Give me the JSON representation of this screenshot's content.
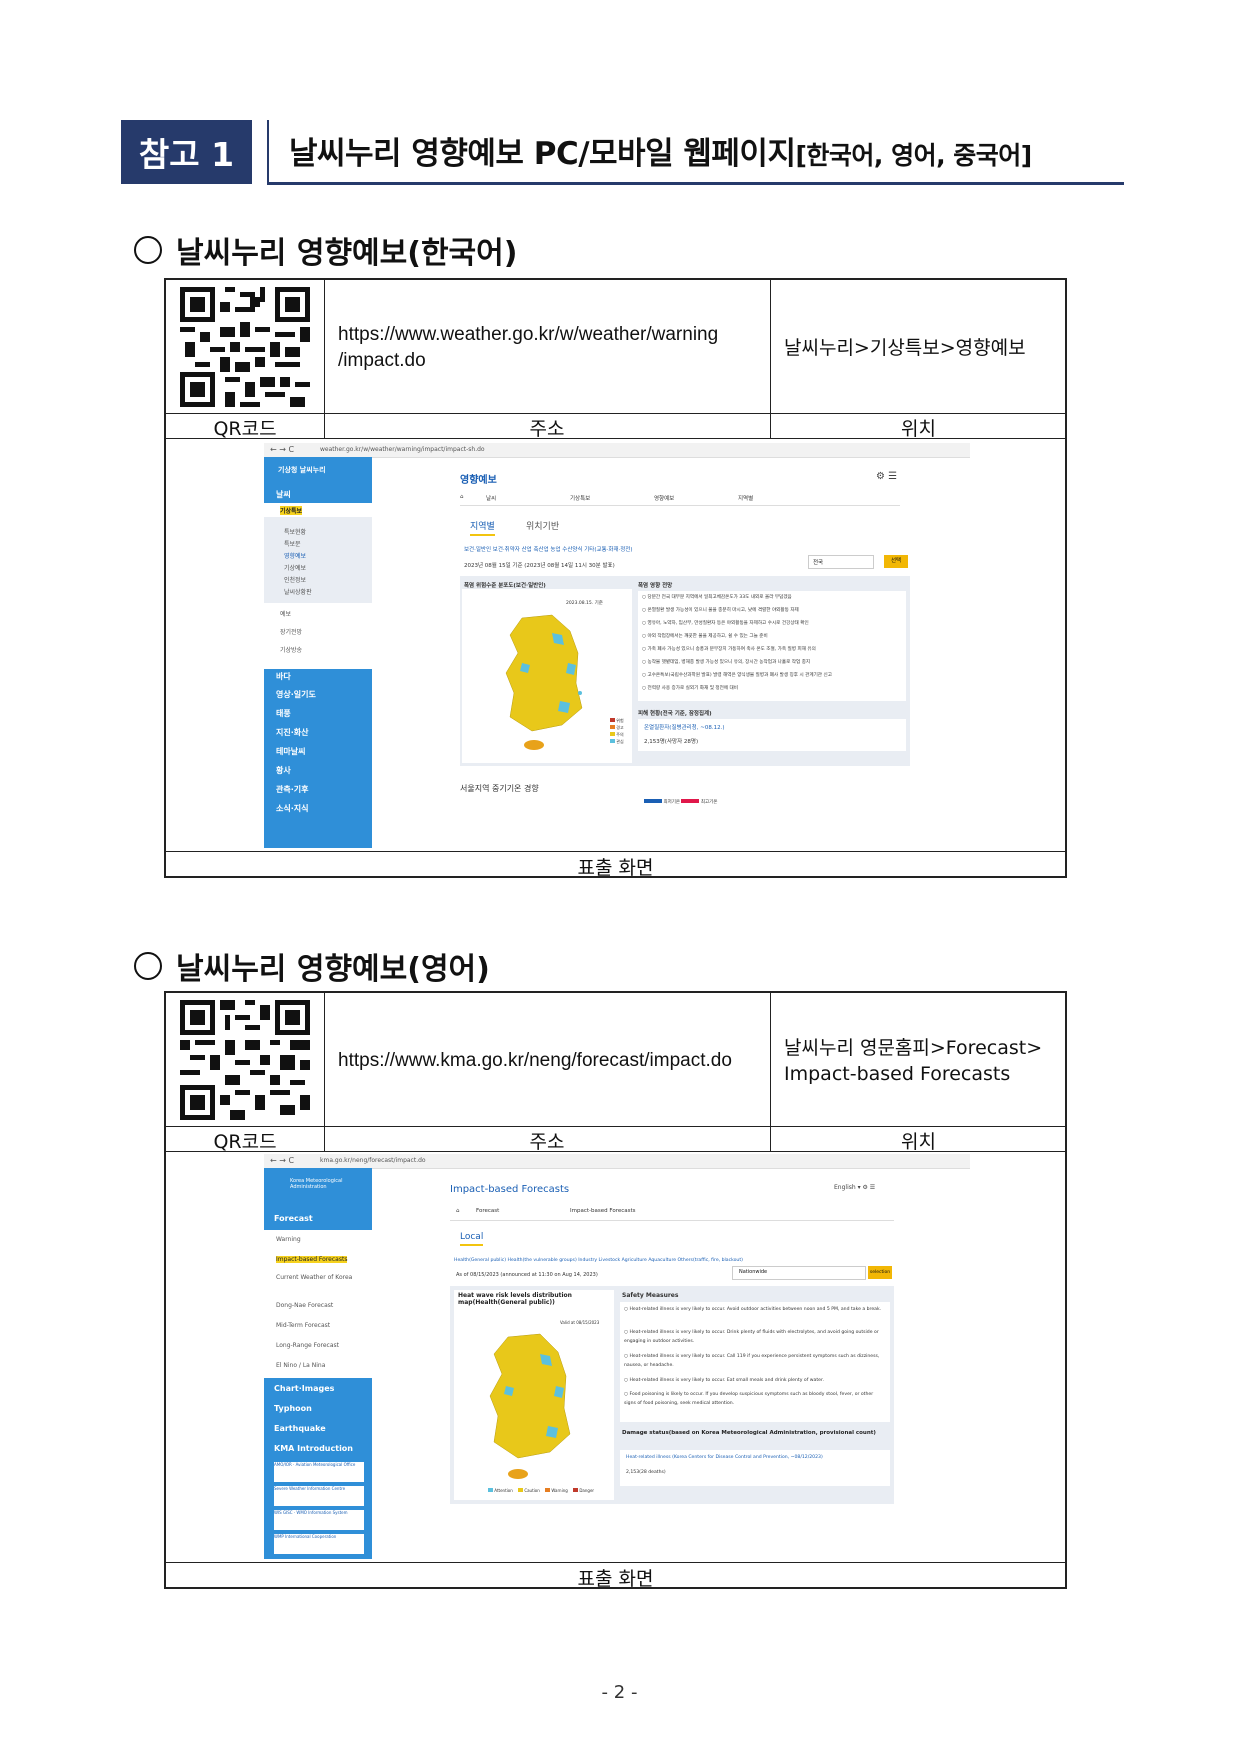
{
  "header": {
    "badge": "참고 1",
    "title_main": "날씨누리 영향예보 PC/모바일 웹페이지",
    "title_suffix": "[한국어, 영어, 중국어]"
  },
  "sections": [
    {
      "heading": "날씨누리 영향예보(한국어)",
      "url_line1": "https://www.weather.go.kr/w/weather/warning",
      "url_line2": "/impact.do",
      "location": "날씨누리>기상특보>영향예보",
      "labels": {
        "qr": "QR코드",
        "address": "주소",
        "location": "위치",
        "screen": "표출 화면"
      },
      "screenshot": {
        "browser_url": "weather.go.kr/w/weather/warning/impact/impact-sh.do",
        "logo": "기상청 날씨누리",
        "menu": [
          "날씨",
          "기상특보"
        ],
        "submenu": [
          "특보현황",
          "특보문",
          "영향예보",
          "기상예보",
          "인천정보",
          "날씨상황판"
        ],
        "menu_lower": [
          "예보",
          "장기전망",
          "기상방송"
        ],
        "menu_blue": [
          "바다",
          "영상·일기도",
          "태풍",
          "지진·화산",
          "테마날씨",
          "황사",
          "관측·기후",
          "소식·지식"
        ],
        "page_title": "영향예보",
        "breadcrumb": [
          "날씨",
          "기상특보",
          "영향예보",
          "지역별"
        ],
        "tabs": [
          "지역별",
          "위치기반"
        ],
        "categories": "보건·일반인  보건·취약자  산업  축산업  농업  수산양식  기타(교통·화재·정전)",
        "as_of": "2023년 08월 15일 기준 (2023년 08월 14일 11시 30분 발표)",
        "region": "전국",
        "select": "선택",
        "map_title": "폭염 위험수준 분포도(보건·일반인)",
        "map_date": "2023.08.15. 기준",
        "outlook_title": "폭염 영향 전망",
        "outlook_items": [
          "당분간 전국 대부분 지역에서 일최고체감온도가 33도 내외로 올라 무덥겠음",
          "온열질환 발생 가능성이 있으니 물을 충분히 마시고, 낮에 격렬한 야외활동 자제",
          "영유아, 노약자, 임산부, 만성질환자 등은 야외활동을 자제하고 수시로 건강상태 확인",
          "야외 작업장에서는 깨끗한 물을 제공하고, 쉴 수 있는 그늘 준비",
          "가축 폐사 가능성 있으니 송풍과 분무장치 가동하여 축사 온도 조절, 가축 질병 피해 유의",
          "농작물 햇볕데임, 병해충 발생 가능성 있으니 유의, 장시간 농작업과 나홀로 작업 충지",
          "고수온특보(국립수산과학원 발표) 발령 해역은 양식생물 질병과 폐사 발생 징후 시 관계기관 신고",
          "전력량 사용 증가로 실외기 화재 및 정전에 대비"
        ],
        "damage_title": "피해 현황(전국 기준, 잠정집계)",
        "damage_link": "온열질환자(질병관리청, ~08.12.)",
        "damage_value": "2,153명(사망자 28명)",
        "legend": [
          "위험",
          "경고",
          "주의",
          "관심"
        ],
        "trend": "서울지역 중기기온 경향",
        "trend_legend": [
          "최저기온",
          "최고기온"
        ]
      }
    },
    {
      "heading": "날씨누리 영향예보(영어)",
      "url_line1": "https://www.kma.go.kr/neng/forecast/impact.do",
      "location_line1": "날씨누리 영문홈피>Forecast>",
      "location_line2": "Impact-based  Forecasts",
      "labels": {
        "qr": "QR코드",
        "address": "주소",
        "location": "위치",
        "screen": "표출 화면"
      },
      "screenshot": {
        "browser_url": "kma.go.kr/neng/forecast/impact.do",
        "logo": "Korea Meteorological Administration",
        "menu_top": "Forecast",
        "submenu": [
          "Warning",
          "Impact-based Forecasts",
          "Current Weather of Korea",
          "Dong-Nae Forecast",
          "Mid-Term Forecast",
          "Long-Range Forecast",
          "El Nino / La Nina"
        ],
        "menu_blue": [
          "Chart·Images",
          "Typhoon",
          "Earthquake",
          "KMA Introduction"
        ],
        "banners": [
          "AMO/IOR · Aviation Meteorological Office",
          "Severe Weather Information Centre",
          "WIS GISC · WMO Information System",
          "WMP International Cooperation"
        ],
        "page_title": "Impact-based Forecasts",
        "language": "English",
        "breadcrumb": [
          "Forecast",
          "Impact-based Forecasts"
        ],
        "tab": "Local",
        "categories": "Health(General public)   Health(the vulnerable groups)   Industry   Livestock   Agriculture   Aquaculture   Others(traffic, fire, blackout)",
        "as_of": "As of 08/15/2023 (announced at 11:30 on Aug 14, 2023)",
        "region": "Nationwide",
        "select": "selection",
        "map_title": "Heat wave risk levels distribution map(Health(General public))",
        "valid": "Valid at 08/15/2023",
        "safety_title": "Safety Measures",
        "safety_items": [
          "Heat-related illness is very likely to occur. Avoid outdoor activities between noon and 5 PM, and take a break.",
          "Heat-related illness is very likely to occur. Drink plenty of fluids with electrolytes, and avoid going outside or engaging in outdoor activities.",
          "Heat-related illness is very likely to occur. Call 119 if you experience persistent symptoms such as dizziness, nausea, or headache.",
          "Heat-related illness is very likely to occur. Eat small meals and drink plenty of water.",
          "Food poisoning is likely to occur. If you develop suspicious symptoms such as bloody stool, fever, or other signs of food poisoning, seek medical attention."
        ],
        "damage_title": "Damage status(based on Korea Meteorological Administration, provisional count)",
        "damage_link": "Heat-related illness (Korea Centers for Disease Control and Prevention, ~08/12/2023)",
        "damage_value": "2,153(28 deaths)",
        "legend": [
          "Attention",
          "Caution",
          "Warning",
          "Danger"
        ]
      }
    }
  ],
  "footer": {
    "page": "- 2 -"
  },
  "colors": {
    "navy": "#263a6b",
    "sky": "#2f8fd8",
    "yellow": "#e8c81a",
    "cyan": "#5bc0de",
    "red": "#c0392b"
  }
}
